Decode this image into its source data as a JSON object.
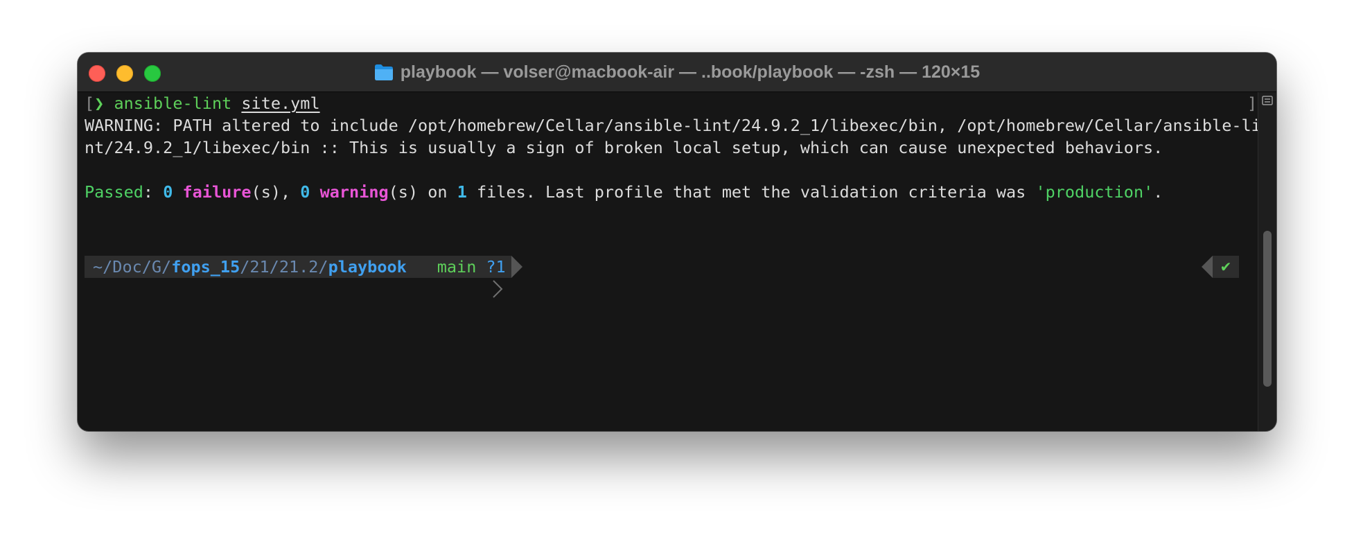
{
  "window": {
    "title": "playbook — volser@macbook-air — ..book/playbook — -zsh — 120×15",
    "folder_icon": "folder-icon"
  },
  "terminal": {
    "line1": {
      "open_bracket": "[",
      "prompt_char": "❯",
      "command": "ansible-lint",
      "argument": "site.yml",
      "close_bracket": "]"
    },
    "warning_line1": "WARNING: PATH altered to include /opt/homebrew/Cellar/ansible-lint/24.9.2_1/libexec/bin, /opt/homebrew/Cellar/ansible-li",
    "warning_line2": "nt/24.9.2_1/libexec/bin :: This is usually a sign of broken local setup, which can cause unexpected behaviors.",
    "result": {
      "passed_label": "Passed",
      "colon": ": ",
      "failures_count": "0",
      "failures_word": "failure",
      "failures_suffix": "(s), ",
      "warnings_count": "0",
      "warnings_word": "warning",
      "warnings_suffix": "(s) on ",
      "files_count": "1",
      "files_text": " files. Last profile that met the validation criteria was ",
      "profile": "'production'",
      "end": "."
    },
    "prompt": {
      "path_prefix": "~/Doc/G/",
      "path_highlight": "fops_15",
      "path_middle": "/21/21.2/",
      "path_current": "playbook",
      "git_branch": "main",
      "git_status": "?1",
      "right_status": "✔"
    }
  },
  "colors": {
    "background": "#161616",
    "green": "#5ed05a",
    "cyan": "#40b9e8",
    "magenta": "#e855d6",
    "blue": "#40a0f0"
  }
}
